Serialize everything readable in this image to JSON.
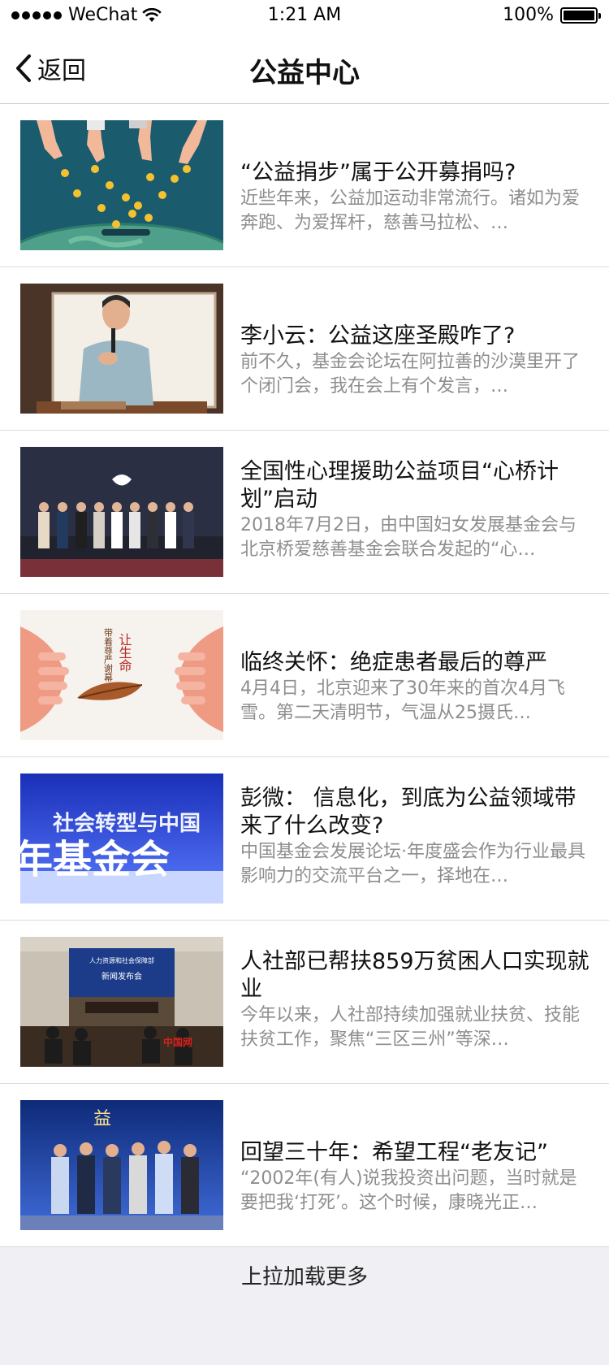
{
  "status_bar": {
    "carrier": "WeChat",
    "time": "1:21 AM",
    "battery": "100%"
  },
  "nav": {
    "back_label": "返回",
    "title": "公益中心"
  },
  "articles": [
    {
      "title": "“公益捐步”属于公开募捐吗?",
      "summary": "近些年来，公益加运动非常流行。诸如为爱奔跑、为爱挥杆，慈善马拉松、…"
    },
    {
      "title": "李小云：公益这座圣殿咋了?",
      "summary": "前不久，基金会论坛在阿拉善的沙漠里开了个闭门会，我在会上有个发言，…"
    },
    {
      "title": "全国性心理援助公益项目“心桥计划”启动",
      "summary": "2018年7月2日，由中国妇女发展基金会与北京桥爱慈善基金会联合发起的“心…"
    },
    {
      "title": "临终关怀：绝症患者最后的尊严",
      "summary": "4月4日，北京迎来了30年来的首次4月飞雪。第二天清明节，气温从25摄氏…",
      "image_text": [
        "让生命",
        "带着尊严谢幕"
      ]
    },
    {
      "title": "彭微：  信息化，到底为公益领域带来了什么改变?",
      "summary": "中国基金会发展论坛·年度盛会作为行业最具影响力的交流平台之一，择地在…",
      "image_text": [
        "社会转型与中国",
        "年基金会"
      ]
    },
    {
      "title": "人社部已帮扶859万贫困人口实现就业",
      "summary": "今年以来，人社部持续加强就业扶贫、技能扶贫工作，聚焦“三区三州”等深…",
      "image_text": [
        "人力资源和社会保障部",
        "新闻发布会",
        "中国网"
      ]
    },
    {
      "title": "回望三十年：希望工程“老友记”",
      "summary": "“2002年(有人)说我投资出问题，当时就是要把我‘打死’。这个时候，康晓光正…",
      "image_text": [
        "益"
      ]
    }
  ],
  "load_more": "上拉加载更多"
}
